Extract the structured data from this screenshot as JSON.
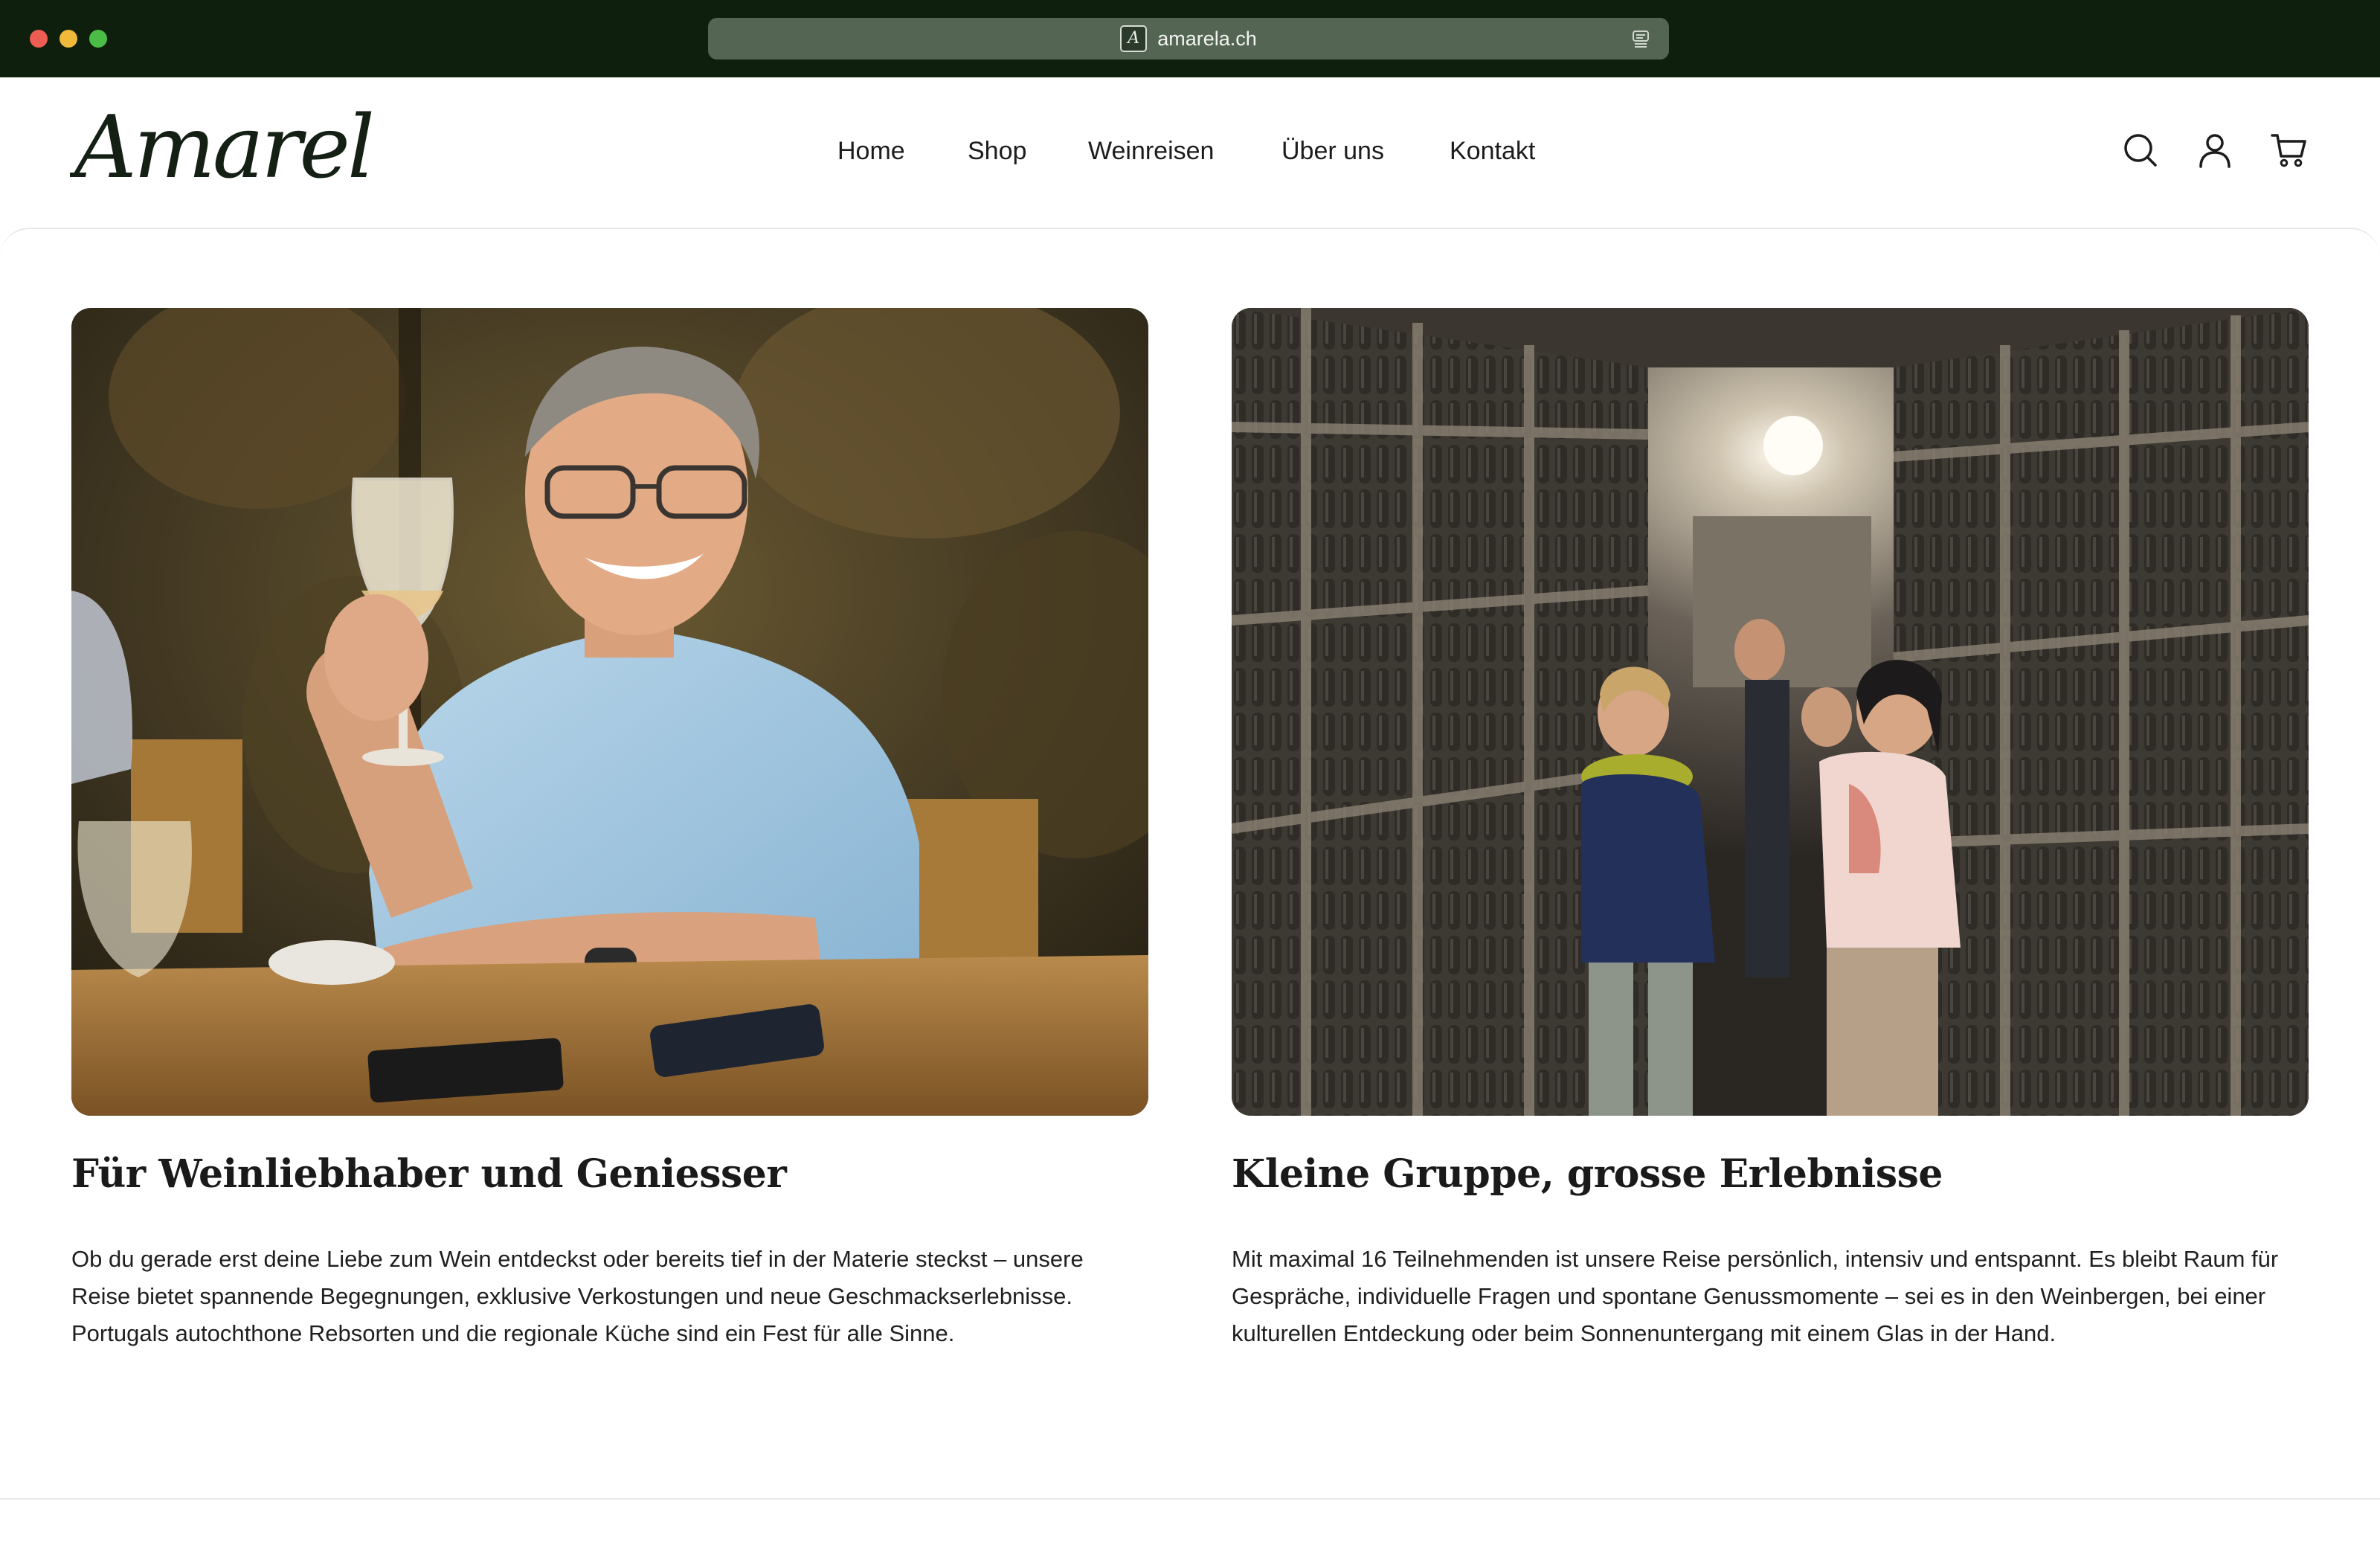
{
  "browser": {
    "url": "amarela.ch",
    "favicon_glyph": "A"
  },
  "header": {
    "logo_text": "Amarela",
    "nav": {
      "home": "Home",
      "shop": "Shop",
      "weinreisen": "Weinreisen",
      "ueber_uns": "Über uns",
      "kontakt": "Kontakt"
    },
    "icons": [
      "search-icon",
      "account-icon",
      "cart-icon"
    ]
  },
  "cards": [
    {
      "image": "man-raising-wine-glass-photo",
      "title": "Für Weinliebhaber und Geniesser",
      "body": "Ob du gerade erst deine Liebe zum Wein entdeckst oder bereits tief in der Materie steckst – unsere Reise bietet spannende Begegnungen, exklusive Verkostungen und neue Geschmackserlebnisse. Portugals autochthone Rebsorten und die regionale Küche sind ein Fest für alle Sinne."
    },
    {
      "image": "group-in-wine-cellar-photo",
      "title": "Kleine Gruppe, grosse Erlebnisse",
      "body": "Mit maximal 16 Teilnehmenden ist unsere Reise persönlich, intensiv und entspannt. Es bleibt Raum für Gespräche, individuelle Fragen und spontane Genussmomente – sei es in den Weinbergen, bei einer kulturellen Entdeckung oder beim Sonnenuntergang mit einem Glas in der Hand."
    }
  ],
  "colors": {
    "chrome_bg": "#0f1f0e",
    "urlbar_bg": "#556553",
    "text": "#1a1a1a"
  }
}
